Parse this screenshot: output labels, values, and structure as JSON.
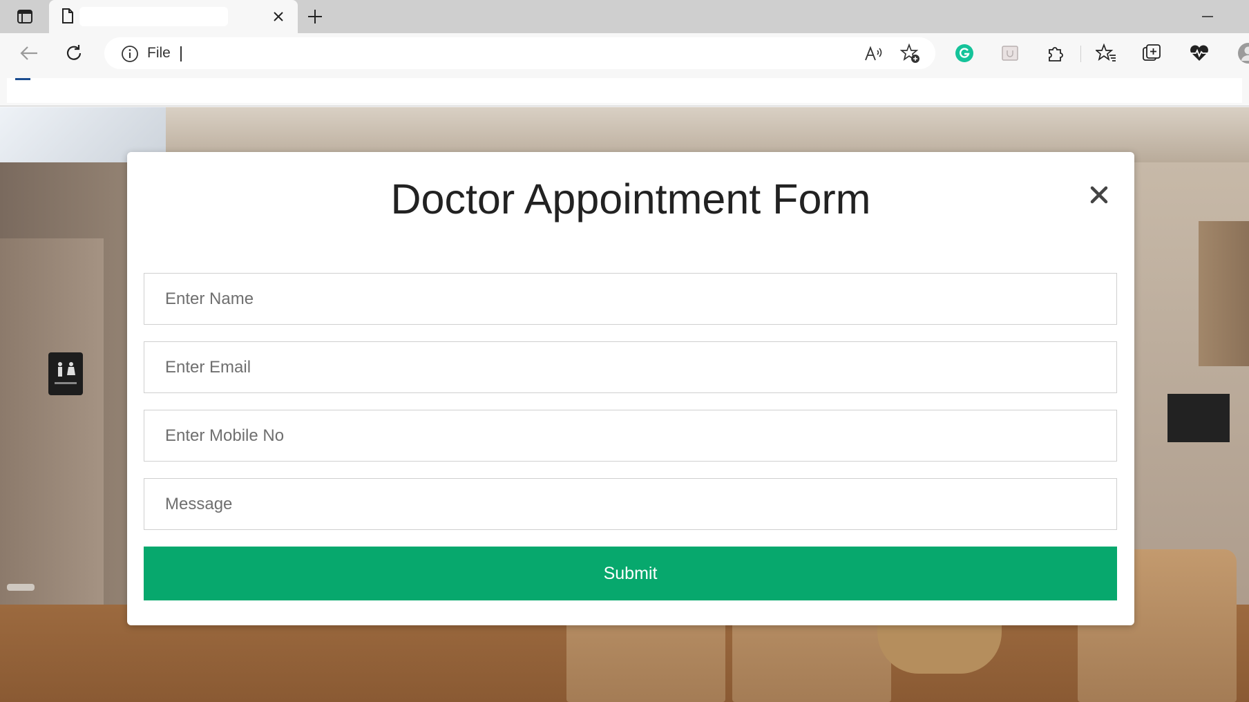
{
  "browser": {
    "tab_title": "",
    "address_scheme": "File",
    "address_url": "",
    "icons": {
      "tab_actions": "tab-actions-icon",
      "tab_page": "page-icon",
      "tab_close": "close-icon",
      "new_tab": "plus-icon",
      "minimize": "minimize-icon",
      "back": "arrow-left-icon",
      "refresh": "refresh-icon",
      "site_info": "info-icon",
      "read_aloud": "read-aloud-icon",
      "add_favorite": "star-plus-icon",
      "grammarly": "grammarly-icon",
      "extension_box": "extension-box-icon",
      "extensions": "puzzle-icon",
      "favorites": "favorites-icon",
      "collections": "collections-icon",
      "health": "heart-pulse-icon",
      "profile": "avatar"
    },
    "colors": {
      "grammarly": "#15c39a",
      "tabstrip": "#cfcfcf",
      "toolbar": "#f7f7f7"
    }
  },
  "modal": {
    "title": "Doctor Appointment Form",
    "close_label": "✕",
    "fields": {
      "name": {
        "placeholder": "Enter Name",
        "value": ""
      },
      "email": {
        "placeholder": "Enter Email",
        "value": ""
      },
      "mobile": {
        "placeholder": "Enter Mobile No",
        "value": ""
      },
      "message": {
        "placeholder": "Message",
        "value": ""
      }
    },
    "submit_label": "Submit",
    "colors": {
      "submit": "#07a86d"
    }
  },
  "background": {
    "description_icon": "restroom-sign-icon"
  }
}
